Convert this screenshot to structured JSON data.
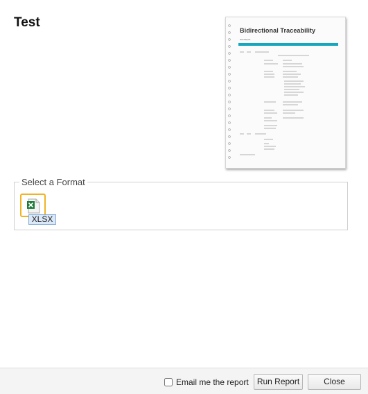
{
  "dialog": {
    "title": "Test"
  },
  "preview": {
    "title": "Bidirectional Traceability",
    "subtitle": "Test Report"
  },
  "format_section": {
    "legend": "Select a Format",
    "options": [
      {
        "label": "XLSX",
        "icon": "excel-file-icon",
        "selected": true
      }
    ]
  },
  "footer": {
    "email_label": "Email me the report",
    "email_checked": false,
    "run_label": "Run Report",
    "close_label": "Close"
  },
  "colors": {
    "selection_outline": "#f0b323",
    "preview_accent": "#17a6c0"
  }
}
